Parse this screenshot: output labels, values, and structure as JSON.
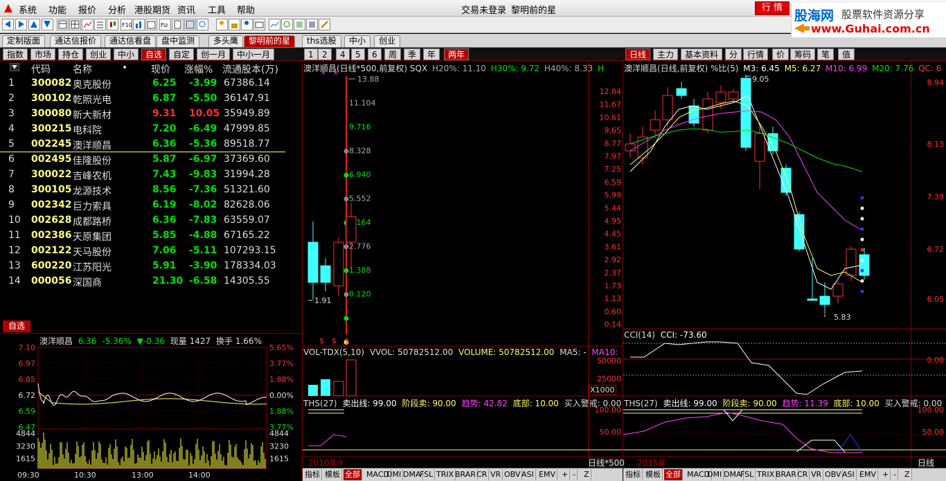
{
  "menu": {
    "items": [
      "系统",
      "功能",
      "报价",
      "分析",
      "港股期货",
      "资讯",
      "工具",
      "帮助"
    ],
    "center_status": "交易未登录",
    "center_title": "黎明前的星",
    "trade_button": "行 情"
  },
  "logo": {
    "brand": "股海网",
    "slogan": "股票软件资源分享",
    "url": "www.Guhai.com.cn"
  },
  "page_tabs": [
    "定制版面",
    "通达信报价",
    "通达信看盘",
    "盘中监测",
    "多头鹰",
    "黎明前的星",
    "ths选股",
    "中小",
    "创业"
  ],
  "active_page_tab": "黎明前的星",
  "list_tabs": [
    "指数",
    "市场",
    "持仓",
    "创业",
    "中小",
    "自选",
    "自定",
    "创一月",
    "中小一月"
  ],
  "active_list_tab": "自选",
  "period_tabs_mid": [
    "1",
    "2",
    "4",
    "5",
    "6",
    "周",
    "季",
    "年",
    "两年"
  ],
  "period_tabs_right": [
    "日线",
    "主力",
    "基本资料",
    "分",
    "行情",
    "价",
    "筹码",
    "笔",
    "值"
  ],
  "table": {
    "headers": [
      "代码",
      "名称",
      "•",
      "现价",
      "涨幅%",
      "流通股本(万)"
    ],
    "rows": [
      {
        "no": "1",
        "code": "300082",
        "name": "奥克股份",
        "price": "6.25",
        "chg": "-3.99",
        "shares": "67386.14",
        "color": "#00e000"
      },
      {
        "no": "2",
        "code": "300102",
        "name": "乾照光电",
        "price": "6.87",
        "chg": "-5.50",
        "shares": "36147.91",
        "color": "#00e000"
      },
      {
        "no": "3",
        "code": "300080",
        "name": "新大新材",
        "price": "9.31",
        "chg": "10.05",
        "shares": "35949.89",
        "color": "#ff3030"
      },
      {
        "no": "4",
        "code": "300215",
        "name": "电科院",
        "price": "7.20",
        "chg": "-6.49",
        "shares": "47999.85",
        "color": "#00e000"
      },
      {
        "no": "5",
        "code": "002245",
        "name": "澳洋顺昌",
        "price": "6.36",
        "chg": "-5.36",
        "shares": "89518.77",
        "color": "#00e000"
      },
      {
        "no": "6",
        "code": "002495",
        "name": "佳隆股份",
        "price": "5.87",
        "chg": "-6.97",
        "shares": "37369.60",
        "color": "#00e000"
      },
      {
        "no": "7",
        "code": "300022",
        "name": "吉峰农机",
        "price": "7.43",
        "chg": "-9.83",
        "shares": "31994.28",
        "color": "#00e000"
      },
      {
        "no": "8",
        "code": "300105",
        "name": "龙源技术",
        "price": "8.56",
        "chg": "-7.36",
        "shares": "51321.60",
        "color": "#00e000"
      },
      {
        "no": "9",
        "code": "002342",
        "name": "巨力索具",
        "price": "6.19",
        "chg": "-8.02",
        "shares": "82628.06",
        "color": "#00e000"
      },
      {
        "no": "10",
        "code": "002628",
        "name": "成都路桥",
        "price": "6.36",
        "chg": "-7.83",
        "shares": "63559.07",
        "color": "#00e000"
      },
      {
        "no": "11",
        "code": "002386",
        "name": "天原集团",
        "price": "5.85",
        "chg": "-4.88",
        "shares": "67165.22",
        "color": "#00e000"
      },
      {
        "no": "12",
        "code": "002122",
        "name": "天马股份",
        "price": "7.06",
        "chg": "-5.11",
        "shares": "107293.15",
        "color": "#00e000"
      },
      {
        "no": "13",
        "code": "600220",
        "name": "江苏阳光",
        "price": "5.91",
        "chg": "-3.90",
        "shares": "178334.03",
        "color": "#00e000"
      },
      {
        "no": "14",
        "code": "000056",
        "name": "深国商",
        "price": "21.30",
        "chg": "-6.58",
        "shares": "14305.55",
        "color": "#00e000"
      }
    ]
  },
  "zixuan_label": "自选",
  "intraday": {
    "name": "澳洋顺昌",
    "price": "6.36",
    "pct": "-5.36%",
    "chg": "▼-0.36",
    "vol_label": "现量",
    "vol": "1427",
    "turn_label": "换手",
    "turn": "1.66%",
    "left_ticks": [
      "7.10",
      "6.97",
      "6.85",
      "6.72",
      "6.59",
      "6.47",
      "4844",
      "3230",
      "1615"
    ],
    "right_ticks": [
      "5.65%",
      "3.77%",
      "1.88%",
      "0.00%",
      "1.88%",
      "3.77%",
      "4844",
      "3230",
      "1615"
    ],
    "times": [
      "09:30",
      "10:30",
      "13:00",
      "14:00"
    ]
  },
  "mid_chart": {
    "title": "澳洋顺昌(日线*500,前复权) SQX",
    "h20": "H20%: 11.10",
    "h30": "H30%: 9.72",
    "h40": "H40%: 8.33",
    "marker_h": "H",
    "levels": [
      "13.88",
      "11.104",
      "9.716",
      "8.328",
      "6.940",
      "5.552",
      "4.164",
      "2.776",
      "1.388",
      "0.120"
    ],
    "low_label": "1.91",
    "axis": [
      "12.84",
      "11.67",
      "10.61",
      "9.65",
      "8.77",
      "7.97",
      "7.25",
      "6.59",
      "5.99",
      "5.44",
      "4.95",
      "4.45",
      "3.61",
      "2.92",
      "2.37",
      "1.73",
      "1.13",
      "0.60",
      "0.14"
    ],
    "vol_title": "VOL-TDX(5,10)",
    "vvol": "VVOL: 50782512.00",
    "volume": "VOLUME: 50782512.00",
    "ma5": "MA5: -",
    "ma10": "MA10:",
    "vol_axis": [
      "50000",
      "25000"
    ],
    "vol_unit": "X1000",
    "ths_title": "THS(27)",
    "sell": "卖出线: 99.00",
    "stage": "阶段卖: 90.00",
    "trend": "趋势: 42.82",
    "bottom": "底部: 10.00",
    "buy": "买入警戒: 0.00",
    "ths_axis": [
      "100.00",
      "50.00"
    ],
    "year": "2010年9",
    "axis_tag": "日线*500"
  },
  "right_chart": {
    "title": "澳洋顺昌(日线,前复权) %比(5)",
    "m3": "M3: 6.45",
    "m5": "M5: 6.27",
    "m10": "M10: 6.99",
    "m20": "M20: 7.76",
    "qc": "QC: 6",
    "high_label": "9.05",
    "low_label": "5.83",
    "axis": [
      "8.94",
      "8.13",
      "7.39",
      "6.72",
      "6.05"
    ],
    "cci_title": "CCI(14)",
    "cci_val": "CCI: -73.60",
    "cci_axis": "0.00",
    "ths_title": "THS(27)",
    "sell": "卖出线: 99.00",
    "stage": "阶段卖: 90.00",
    "trend": "趋势: 11.39",
    "bottom": "底部: 10.00",
    "buy": "买入警戒: 0.00",
    "ths_axis": [
      "100.00",
      "50.00"
    ],
    "year": "2015年",
    "axis_tag": "日线"
  },
  "bottom_tabs": [
    "指标",
    "模板",
    "全部",
    "MACD",
    "DMI",
    "DMA",
    "FSL",
    "TRIX",
    "BRAR",
    "CR",
    "VR",
    "OBV",
    "ASI",
    "EMV"
  ],
  "bottom_nav": [
    "+",
    "-",
    "Z"
  ],
  "colors": {
    "up": "#ff3030",
    "down": "#00e000",
    "code": "#ffff80",
    "cyan": "#40ffff",
    "grid": "#800000"
  }
}
